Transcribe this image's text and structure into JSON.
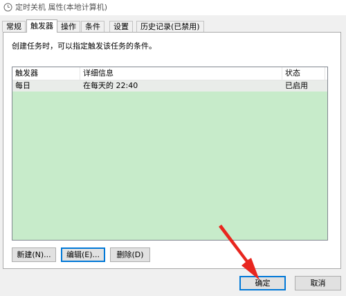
{
  "window": {
    "title": "定时关机 属性(本地计算机)",
    "icon": "clock-icon"
  },
  "tabs": [
    {
      "label": "常规",
      "active": false
    },
    {
      "label": "触发器",
      "active": true
    },
    {
      "label": "操作",
      "active": false
    },
    {
      "label": "条件",
      "active": false
    },
    {
      "label": "设置",
      "active": false
    },
    {
      "label": "历史记录(已禁用)",
      "active": false
    }
  ],
  "panel": {
    "description": "创建任务时，可以指定触发该任务的条件。"
  },
  "triggers_table": {
    "columns": [
      "触发器",
      "详细信息",
      "状态"
    ],
    "rows": [
      {
        "trigger": "每日",
        "details": "在每天的 22:40",
        "status": "已启用"
      }
    ]
  },
  "buttons": {
    "new": "新建(N)...",
    "edit": "编辑(E)...",
    "delete": "删除(D)",
    "ok": "确定",
    "cancel": "取消"
  },
  "colors": {
    "list_background": "#c7ebca",
    "arrow": "#e8261f",
    "focus": "#0078d7"
  }
}
